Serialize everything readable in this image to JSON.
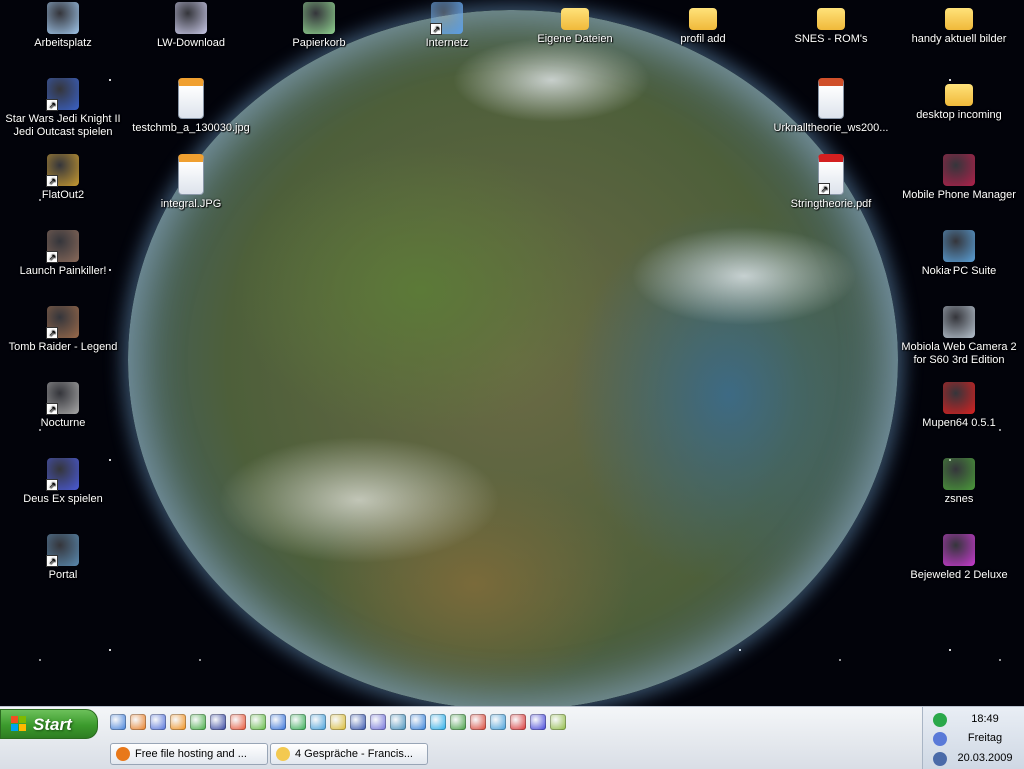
{
  "desktop": {
    "icons": [
      {
        "label": "Arbeitsplatz",
        "icon": "my-computer-icon",
        "color": "#9fc5ea"
      },
      {
        "label": "LW-Download",
        "icon": "cd-drive-icon",
        "color": "#c9c9e8"
      },
      {
        "label": "Papierkorb",
        "icon": "recycle-bin-icon",
        "color": "#8fd18f"
      },
      {
        "label": "Internetz",
        "icon": "network-icon",
        "color": "#5a9ee8"
      },
      {
        "label": "Eigene Dateien",
        "icon": "my-documents-folder-icon",
        "color": "#f3c950"
      },
      {
        "label": "profil add",
        "icon": "folder-icon",
        "color": "#f3c950"
      },
      {
        "label": "SNES - ROM's",
        "icon": "folder-icon",
        "color": "#f3c950"
      },
      {
        "label": "handy aktuell bilder",
        "icon": "folder-icon",
        "color": "#f3c950"
      },
      {
        "label": "Star Wars Jedi Knight II Jedi Outcast spielen",
        "icon": "jedi-outcast-icon",
        "color": "#3a62c8"
      },
      {
        "label": "testchmb_a_130030.jpg",
        "icon": "jpg-file-icon",
        "color": "#f0a030"
      },
      {
        "label": "Urknalltheorie_ws200...",
        "icon": "powerpoint-file-icon",
        "color": "#d0502a"
      },
      {
        "label": "desktop incoming",
        "icon": "folder-icon",
        "color": "#f3c950"
      },
      {
        "label": "FlatOut2",
        "icon": "flatout2-icon",
        "color": "#c89a30"
      },
      {
        "label": "integral.JPG",
        "icon": "jpg-file-icon",
        "color": "#f0a030"
      },
      {
        "label": "Stringtheorie.pdf",
        "icon": "pdf-file-icon",
        "color": "#d42020"
      },
      {
        "label": "Mobile Phone Manager",
        "icon": "phone-manager-icon",
        "color": "#b0204a"
      },
      {
        "label": "Launch Painkiller!",
        "icon": "painkiller-icon",
        "color": "#8a6a5a"
      },
      {
        "label": "Nokia PC Suite",
        "icon": "nokia-pc-suite-icon",
        "color": "#5aa0d8"
      },
      {
        "label": "Tomb Raider - Legend",
        "icon": "tomb-raider-icon",
        "color": "#9a6a4a"
      },
      {
        "label": "Mobiola Web Camera 2 for S60 3rd Edition",
        "icon": "webcam-icon",
        "color": "#b8c4d0"
      },
      {
        "label": "Nocturne",
        "icon": "moon-icon",
        "color": "#a8a8a8"
      },
      {
        "label": "Mupen64 0.5.1",
        "icon": "mupen64-icon",
        "color": "#d82020"
      },
      {
        "label": "Deus Ex spielen",
        "icon": "deus-ex-icon",
        "color": "#4a5ad8"
      },
      {
        "label": "zsnes",
        "icon": "zsnes-icon",
        "color": "#4a9a3a"
      },
      {
        "label": "Portal",
        "icon": "portal-icon",
        "color": "#5a8ab0"
      },
      {
        "label": "Bejeweled 2 Deluxe",
        "icon": "bejeweled-icon",
        "color": "#c83ad0"
      }
    ]
  },
  "taskbar": {
    "start_label": "Start",
    "quick_launch": [
      {
        "icon": "internet-explorer-icon",
        "color": "#3a7ad8"
      },
      {
        "icon": "firefox-icon",
        "color": "#e8781a"
      },
      {
        "icon": "media-player-icon",
        "color": "#4a6ad8"
      },
      {
        "icon": "vlc-icon",
        "color": "#f08a10"
      },
      {
        "icon": "utorrent-icon",
        "color": "#3aa83a"
      },
      {
        "icon": "winamp-icon",
        "color": "#2a3a9a"
      },
      {
        "icon": "mail-icon",
        "color": "#e84a2a"
      },
      {
        "icon": "antivirus-icon",
        "color": "#5ab83a"
      },
      {
        "icon": "teamspeak-icon",
        "color": "#2a6ad8"
      },
      {
        "icon": "shamrock-icon",
        "color": "#2aa84a"
      },
      {
        "icon": "chat-icon",
        "color": "#3a9ad8"
      },
      {
        "icon": "star-icon",
        "color": "#d8b82a"
      },
      {
        "icon": "photoshop-icon",
        "color": "#2a4aa8"
      },
      {
        "icon": "image-viewer-icon",
        "color": "#6a6ad8"
      },
      {
        "icon": "headphones-icon",
        "color": "#3a8ab8"
      },
      {
        "icon": "globe-icon",
        "color": "#2a7ad8"
      },
      {
        "icon": "skype-icon",
        "color": "#1aa8e8"
      },
      {
        "icon": "chart-icon",
        "color": "#3a9a3a"
      },
      {
        "icon": "opera-icon",
        "color": "#d83a2a"
      },
      {
        "icon": "search-icon",
        "color": "#3a9ad8"
      },
      {
        "icon": "alarm-clock-icon",
        "color": "#d82a2a"
      },
      {
        "icon": "grid-icon",
        "color": "#3a3ad8"
      },
      {
        "icon": "notepad-icon",
        "color": "#8ab83a"
      }
    ],
    "tasks": [
      {
        "label": "Free file hosting and ...",
        "icon": "firefox-icon",
        "color": "#e8781a"
      },
      {
        "label": "4 Gespräche - Francis...",
        "icon": "folder-icon",
        "color": "#f3c950"
      }
    ],
    "tray": {
      "icons": [
        {
          "icon": "shamrock-tray-icon",
          "color": "#2aa84a"
        },
        {
          "icon": "network-tray-icon",
          "color": "#5a7ad8"
        },
        {
          "icon": "volume-tray-icon",
          "color": "#4a6aa8"
        }
      ],
      "time": "18:49",
      "weekday": "Freitag",
      "date": "20.03.2009"
    }
  }
}
